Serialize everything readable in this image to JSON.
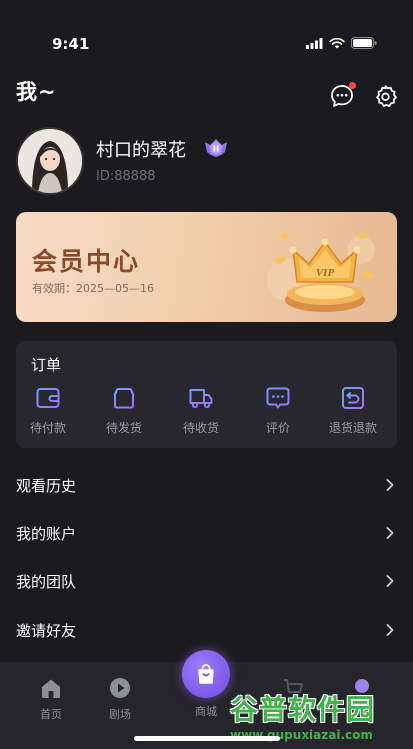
{
  "status_bar": {
    "time": "9:41"
  },
  "header": {
    "title": "我~"
  },
  "profile": {
    "username": "村口的翠花",
    "user_id": "ID:88888"
  },
  "vip_card": {
    "title": "会员中心",
    "expiry": "有效期：2025—05—16",
    "crown_text": "VIP"
  },
  "orders": {
    "title": "订单",
    "items": [
      {
        "label": "待付款",
        "icon": "wallet-icon"
      },
      {
        "label": "待发货",
        "icon": "box-icon"
      },
      {
        "label": "待收货",
        "icon": "truck-icon"
      },
      {
        "label": "评价",
        "icon": "comment-icon"
      },
      {
        "label": "退货退款",
        "icon": "return-icon"
      }
    ]
  },
  "menu": [
    {
      "label": "观看历史"
    },
    {
      "label": "我的账户"
    },
    {
      "label": "我的团队"
    },
    {
      "label": "邀请好友"
    }
  ],
  "tabbar": {
    "items": [
      {
        "label": "首页",
        "icon": "home-icon"
      },
      {
        "label": "剧场",
        "icon": "play-icon"
      },
      {
        "label": "商城",
        "icon": "shopping-bag-icon"
      }
    ]
  },
  "watermark": {
    "title": "谷普软件园",
    "url": "www.gupuxiazai.com"
  },
  "colors": {
    "background": "#1b1b1f",
    "accent": "#8a63ff",
    "vip_text": "#8b4a2b",
    "watermark": "#3fb24a"
  }
}
